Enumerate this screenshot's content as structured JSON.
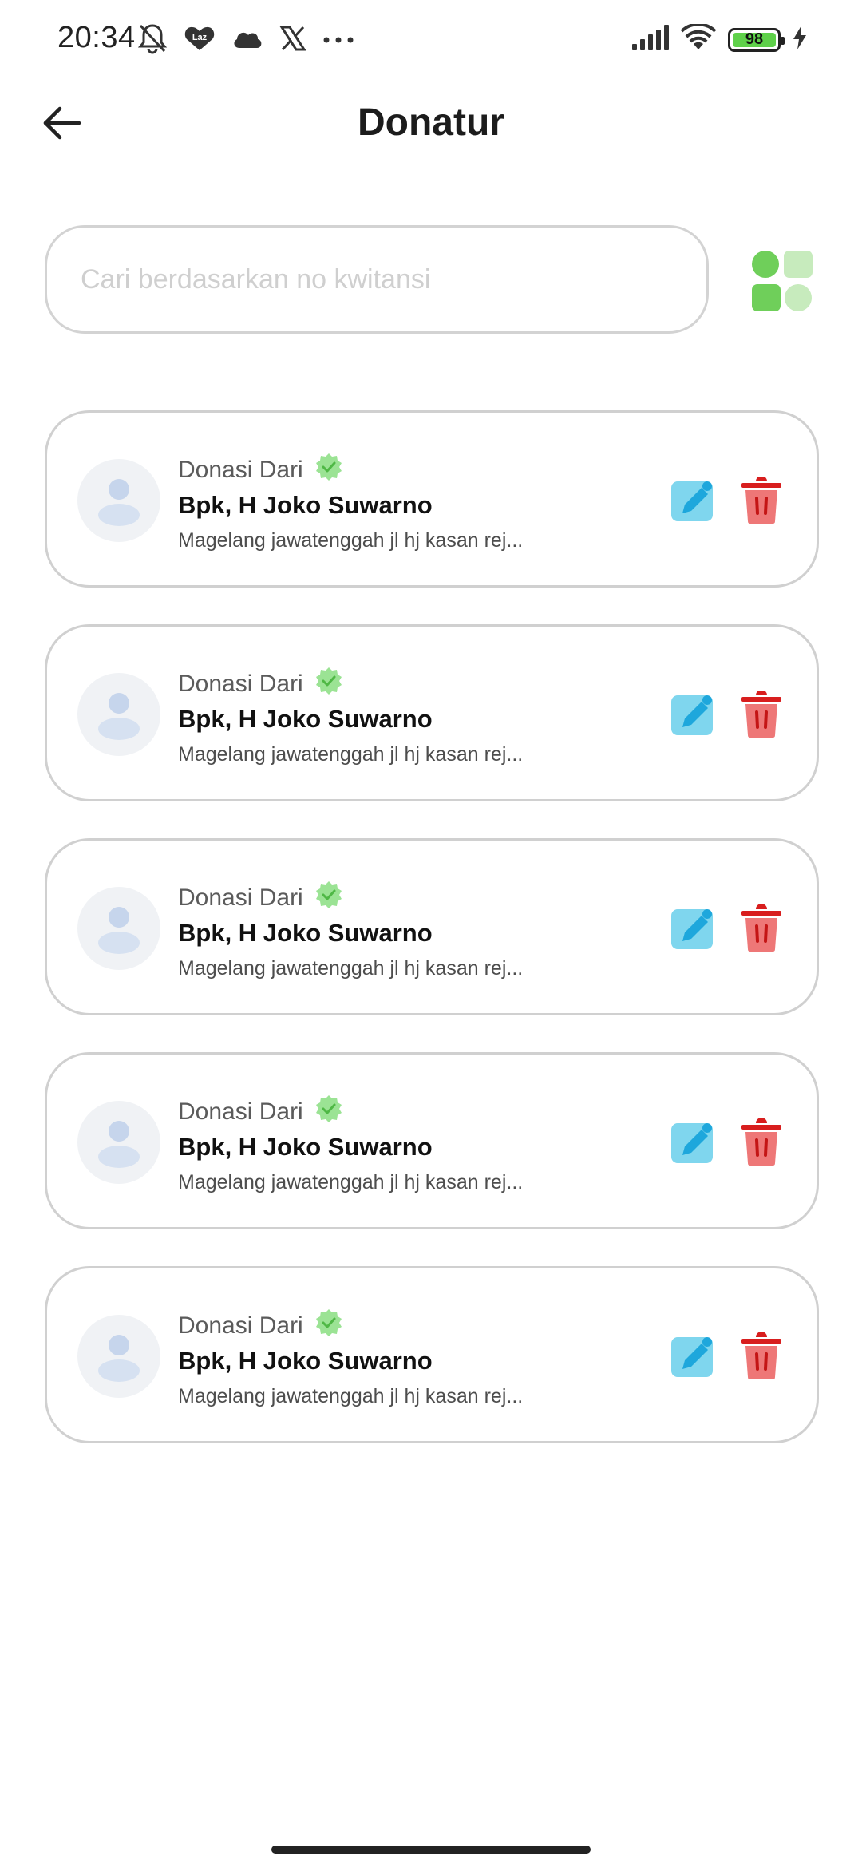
{
  "status_bar": {
    "time": "20:34",
    "left_icons": [
      "bell-off-icon",
      "lazada-icon",
      "cloud-icon",
      "x-icon",
      "more-icon"
    ],
    "battery_level": "98",
    "lazada_text": "Laz"
  },
  "header": {
    "title": "Donatur",
    "back_icon": "arrow-left-icon"
  },
  "search": {
    "placeholder": "Cari berdasarkan no kwitansi",
    "value": ""
  },
  "colors": {
    "accent_green": "#6fcf5a",
    "edit_blue": "#29b6e8",
    "delete_red": "#e02a2a",
    "verified_green": "#8fe08a"
  },
  "donors": [
    {
      "label": "Donasi Dari",
      "name": "Bpk, H Joko Suwarno",
      "address": "Magelang jawatenggah jl hj kasan rej..."
    },
    {
      "label": "Donasi Dari",
      "name": "Bpk, H Joko Suwarno",
      "address": "Magelang jawatenggah jl hj kasan rej..."
    },
    {
      "label": "Donasi Dari",
      "name": "Bpk, H Joko Suwarno",
      "address": "Magelang jawatenggah jl hj kasan rej..."
    },
    {
      "label": "Donasi Dari",
      "name": "Bpk, H Joko Suwarno",
      "address": "Magelang jawatenggah jl hj kasan rej..."
    },
    {
      "label": "Donasi Dari",
      "name": "Bpk, H Joko Suwarno",
      "address": "Magelang jawatenggah jl hj kasan rej..."
    }
  ]
}
